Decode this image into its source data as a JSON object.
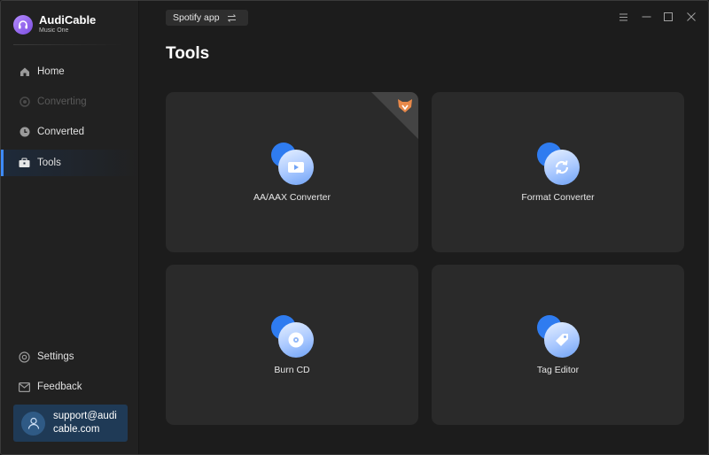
{
  "brand": {
    "name": "AudiCable",
    "subtitle": "Music One"
  },
  "sidebar": {
    "items": [
      {
        "label": "Home",
        "icon": "home-icon",
        "state": "normal"
      },
      {
        "label": "Converting",
        "icon": "converting-icon",
        "state": "disabled"
      },
      {
        "label": "Converted",
        "icon": "clock-icon",
        "state": "normal"
      },
      {
        "label": "Tools",
        "icon": "toolbox-icon",
        "state": "active"
      }
    ],
    "bottom": [
      {
        "label": "Settings",
        "icon": "gear-icon"
      },
      {
        "label": "Feedback",
        "icon": "mail-icon"
      }
    ],
    "account": {
      "email": "support@audicable.com"
    }
  },
  "topbar": {
    "source": "Spotify app"
  },
  "main": {
    "title": "Tools",
    "cards": [
      {
        "label": "AA/AAX Converter",
        "icon": "play-video-icon",
        "badge": "fox-badge-icon"
      },
      {
        "label": "Format Converter",
        "icon": "refresh-icon"
      },
      {
        "label": "Burn CD",
        "icon": "disc-icon"
      },
      {
        "label": "Tag Editor",
        "icon": "tag-icon"
      }
    ]
  },
  "colors": {
    "accent": "#3d8bff",
    "sidebar_bg": "#212121",
    "main_bg": "#1c1c1c",
    "card_bg": "#2a2a2a",
    "account_bg": "#1f3a56",
    "brand_purple": "#9b6bf2"
  }
}
